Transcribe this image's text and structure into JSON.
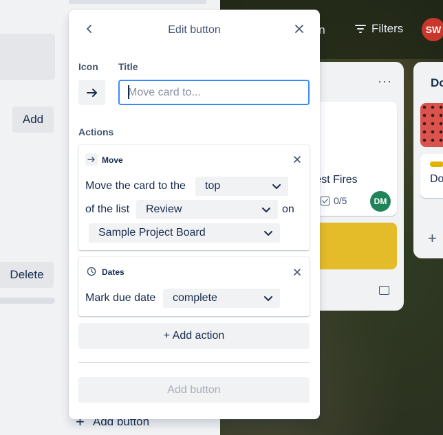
{
  "background": {
    "left": {
      "add_label": "Add",
      "delete_label": "Delete",
      "add_button_label": "Add button"
    },
    "header": {
      "partial_text": "ion",
      "filters_label": "Filters",
      "avatar_initials": "SW"
    },
    "list1": {
      "more_label": "···",
      "card_title": "rest Fires",
      "checklist": "0/5",
      "member_initials": "DM"
    },
    "list2": {
      "title": "Do",
      "card_text": "Do",
      "add_label": "+"
    }
  },
  "popover": {
    "title": "Edit button",
    "icon_label": "Icon",
    "title_label": "Title",
    "title_placeholder": "Move card to...",
    "title_value": "",
    "actions_label": "Actions",
    "move": {
      "heading": "Move",
      "text1": "Move the card to the",
      "position": "top",
      "text2": "of the list",
      "list": "Review",
      "text3": "on",
      "board": "Sample Project Board"
    },
    "dates": {
      "heading": "Dates",
      "text": "Mark due date",
      "value": "complete"
    },
    "add_action_label": "+ Add action",
    "add_button_label": "Add button"
  },
  "colors": {
    "accent": "#388bff",
    "avatar_sw": "#c9372c",
    "avatar_dm": "#1f845a",
    "card_yellow": "#e2b203"
  }
}
